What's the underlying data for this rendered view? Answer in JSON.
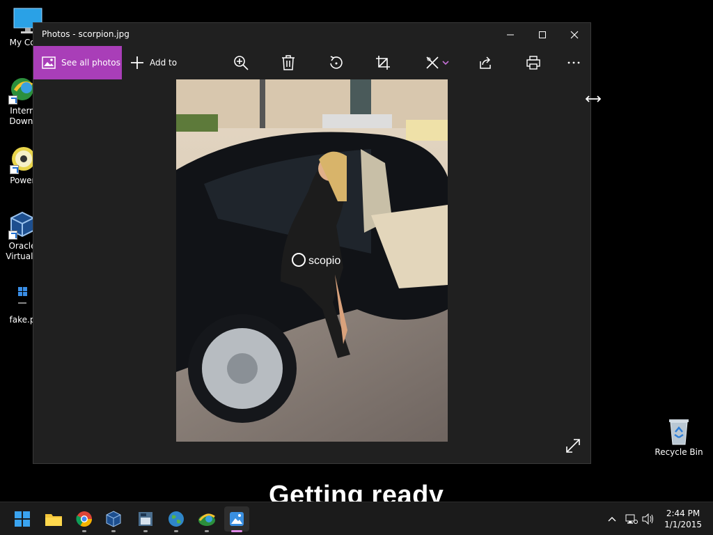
{
  "desktop": {
    "icons": [
      {
        "label": "My Com",
        "icon": "computer-icon"
      },
      {
        "label": "Intern\nDownl",
        "icon": "internet-download-manager-icon"
      },
      {
        "label": "Powerl",
        "icon": "poweriso-icon"
      },
      {
        "label": "Oracle\nVirtualB",
        "icon": "virtualbox-icon"
      },
      {
        "label": "fake.p",
        "icon": "file-icon"
      },
      {
        "label": "Recycle Bin",
        "icon": "recycle-bin-icon"
      }
    ],
    "overlay_text": "Getting ready"
  },
  "window": {
    "title": "Photos - scorpion.jpg",
    "controls": [
      "minimize-icon",
      "maximize-icon",
      "close-icon"
    ],
    "toolbar": {
      "see_all_label": "See all photos",
      "add_to_label": "Add to",
      "tools": [
        "zoom-in-icon",
        "delete-icon",
        "rotate-icon",
        "crop-icon",
        "edit-icon",
        "share-icon",
        "print-icon",
        "more-icon"
      ]
    },
    "photo": {
      "watermark": "scopio"
    }
  },
  "taskbar": {
    "apps": [
      "start-icon",
      "file-explorer-icon",
      "chrome-icon",
      "virtualbox-icon",
      "app-icon",
      "globe-icon",
      "idm-icon",
      "photos-icon"
    ],
    "clock": {
      "time": "2:44 PM",
      "date": "1/1/2015"
    }
  },
  "colors": {
    "accent": "#a93eb8",
    "window_bg": "#202020",
    "taskbar_bg": "#1b1b1b"
  }
}
